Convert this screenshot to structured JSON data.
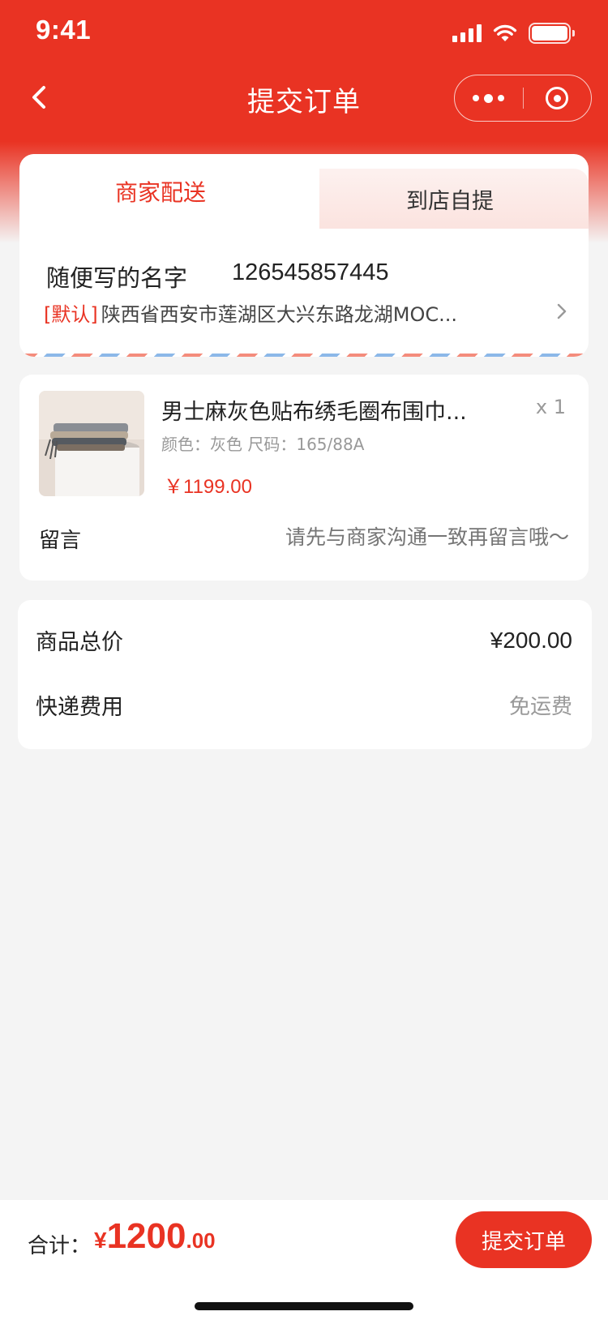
{
  "status_bar": {
    "time": "9:41"
  },
  "nav": {
    "title": "提交订单"
  },
  "colors": {
    "brand": "#e93323",
    "background": "#f4f4f4"
  },
  "delivery_tabs": [
    {
      "label": "商家配送",
      "active": true
    },
    {
      "label": "到店自提",
      "active": false
    }
  ],
  "address": {
    "name": "随便写的名字",
    "phone": "126545857445",
    "default_tag": "[默认]",
    "detail": "陕西省西安市莲湖区大兴东路龙湖MOC..."
  },
  "product": {
    "title": "男士麻灰色贴布绣毛圈布围巾...",
    "qty": "x 1",
    "spec": "颜色：灰色  尺码：165/88A",
    "price": "￥1199.00"
  },
  "message": {
    "label": "留言",
    "placeholder": "请先与商家沟通一致再留言哦～"
  },
  "summary": [
    {
      "label": "商品总价",
      "value": "¥200.00"
    },
    {
      "label": "快递费用",
      "value": "免运费"
    }
  ],
  "footer": {
    "total_label": "合计：",
    "currency": "¥",
    "total_int": "1200",
    "total_dec": ".00",
    "submit_label": "提交订单"
  }
}
